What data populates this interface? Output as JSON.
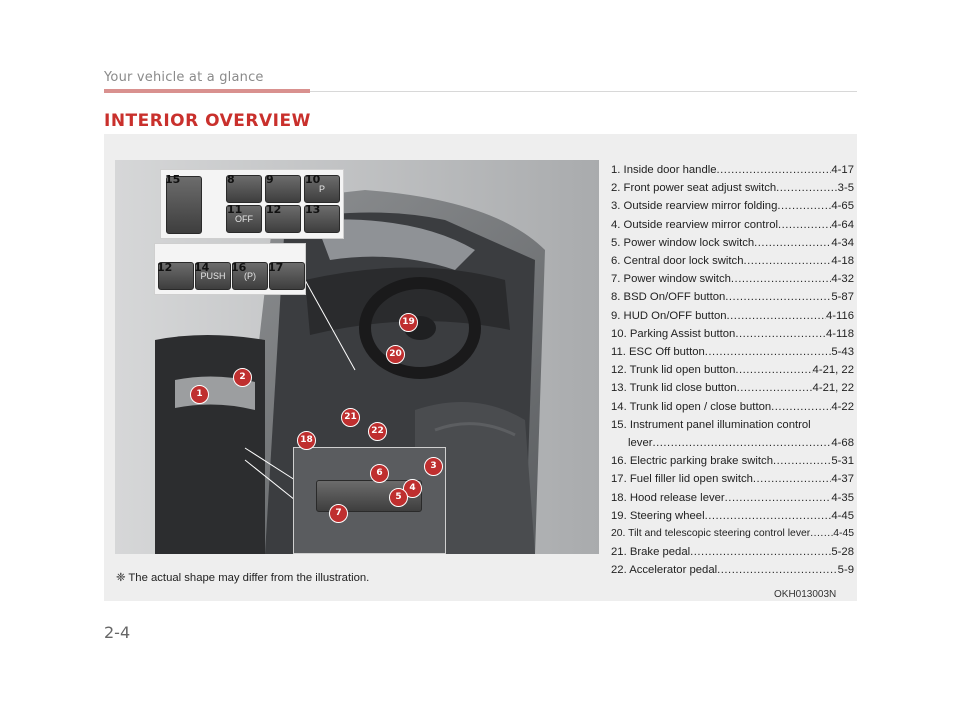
{
  "header": {
    "section": "Your vehicle at a glance",
    "title": "INTERIOR OVERVIEW"
  },
  "illustration": {
    "code": "OKH013003N",
    "note": "❈ The actual shape may differ from the illustration.",
    "callout_upper_top": [
      "15",
      "8",
      "9",
      "10",
      "11",
      "12",
      "13"
    ],
    "callout_upper_bottom": [
      "12",
      "14",
      "16",
      "17"
    ],
    "callout_lower": [
      "6",
      "3",
      "4",
      "5",
      "7"
    ],
    "markers": [
      "1",
      "2",
      "18",
      "19",
      "20",
      "21",
      "22"
    ],
    "button_text": {
      "p_assist": "P",
      "off": "OFF",
      "push": "PUSH",
      "epb": "(P)"
    }
  },
  "legend": [
    {
      "label": "1. Inside door handle ",
      "page": "4-17"
    },
    {
      "label": "2. Front power seat adjust switch ",
      "page": "3-5"
    },
    {
      "label": "3. Outside rearview mirror folding ",
      "page": "4-65"
    },
    {
      "label": "4. Outside rearview mirror control ",
      "page": "4-64"
    },
    {
      "label": "5. Power window lock switch ",
      "page": "4-34"
    },
    {
      "label": "6. Central door lock switch ",
      "page": "4-18"
    },
    {
      "label": "7. Power window switch",
      "page": "4-32"
    },
    {
      "label": "8. BSD On/OFF button ",
      "page": "5-87"
    },
    {
      "label": "9. HUD On/OFF button",
      "page": "4-116"
    },
    {
      "label": "10. Parking Assist button ",
      "page": "4-118"
    },
    {
      "label": "11. ESC Off button ",
      "page": "5-43"
    },
    {
      "label": "12. Trunk lid open button ",
      "page": "4-21, 22"
    },
    {
      "label": "13. Trunk lid close button ",
      "page": "4-21, 22"
    },
    {
      "label": "14. Trunk lid open / close button",
      "page": "4-22"
    },
    {
      "label": "15. Instrument panel illumination control",
      "page": ""
    },
    {
      "label": "lever",
      "page": "4-68"
    },
    {
      "label": "16. Electric parking brake switch",
      "page": "5-31"
    },
    {
      "label": "17. Fuel filler lid open switch ",
      "page": "4-37"
    },
    {
      "label": "18. Hood release lever",
      "page": "4-35"
    },
    {
      "label": "19. Steering wheel ",
      "page": "4-45"
    },
    {
      "label": "20. Tilt and telescopic steering control lever ",
      "page": "4-45"
    },
    {
      "label": "21. Brake pedal",
      "page": "5-28"
    },
    {
      "label": "22. Accelerator pedal ",
      "page": "5-9"
    }
  ],
  "footer": {
    "page_number": "2-4"
  }
}
